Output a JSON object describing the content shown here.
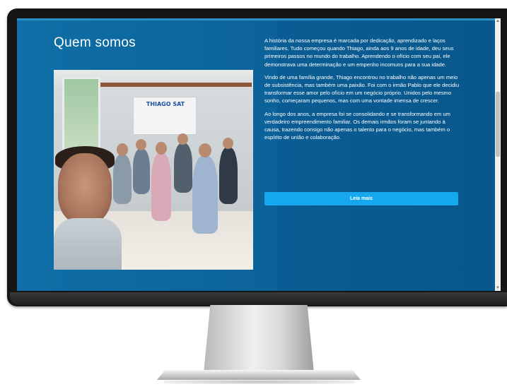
{
  "section": {
    "title": "Quem somos",
    "paragraphs": [
      "A história da nossa empresa é marcada por dedicação, aprendizado e laços familiares. Tudo começou quando Thiago, ainda aos 9 anos de idade, deu seus primeiros passos no mundo do trabalho. Aprendendo o ofício com seu pai, ele demonstrava uma determinação e um empenho incomuns para a sua idade.",
      "Vindo de uma família grande, Thiago encontrou no trabalho não apenas um meio de subsistência, mas também uma paixão. Foi com o irmão Pablo que ele decidiu transformar esse amor pelo ofício em um negócio próprio. Unidos pelo mesmo sonho, começaram pequenos, mas com uma vontade imensa de crescer.",
      "Ao longo dos anos, a empresa foi se consolidando e se transformando em um verdadeiro empreendimento familiar. Os demais irmãos foram se juntando à causa, trazendo consigo não apenas o talento para o negócio, mas também o espírito de união e colaboração."
    ],
    "read_more_label": "Leia mais"
  },
  "photo": {
    "banner_text": "THIAGO SAT"
  },
  "scrollbar": {
    "up_glyph": "▲",
    "down_glyph": "▼"
  },
  "colors": {
    "screen_bg": "#0c639a",
    "button": "#16a8ee",
    "text": "#ffffff",
    "bezel": "#151515"
  }
}
